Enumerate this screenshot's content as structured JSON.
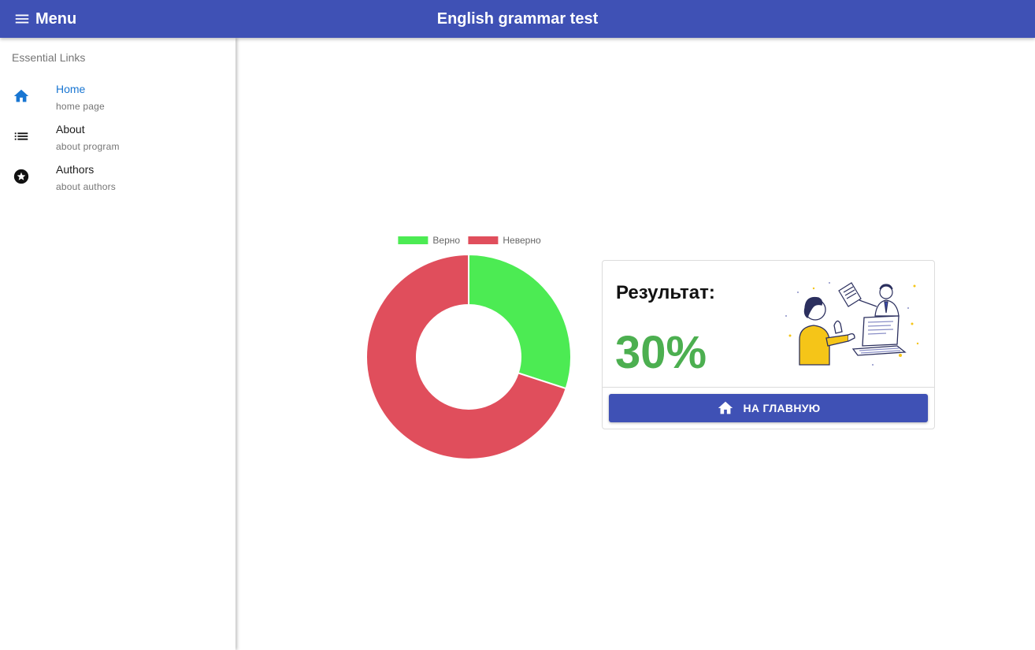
{
  "header": {
    "menu_label": "Menu",
    "title": "English grammar test",
    "menu_icon": "hamburger-menu-icon"
  },
  "drawer": {
    "heading": "Essential Links",
    "items": [
      {
        "label": "Home",
        "caption": "home page",
        "icon": "home-icon",
        "active": true
      },
      {
        "label": "About",
        "caption": "about program",
        "icon": "list-icon",
        "active": false
      },
      {
        "label": "Authors",
        "caption": "about authors",
        "icon": "star-circle-icon",
        "active": false
      }
    ]
  },
  "colors": {
    "primary": "#3f51b5",
    "active_link": "#1976d2",
    "correct": "#4ceb53",
    "incorrect": "#e04e5c",
    "result_green": "#4caf50"
  },
  "chart_data": {
    "type": "pie",
    "donut": true,
    "categories": [
      "Верно",
      "Неверно"
    ],
    "values": [
      30,
      70
    ],
    "colors": [
      "#4ceb53",
      "#e04e5c"
    ],
    "legend_position": "top"
  },
  "result_card": {
    "title": "Результат:",
    "value": "30%",
    "button_label": "НА ГЛАВНУЮ",
    "button_icon": "home-icon"
  }
}
